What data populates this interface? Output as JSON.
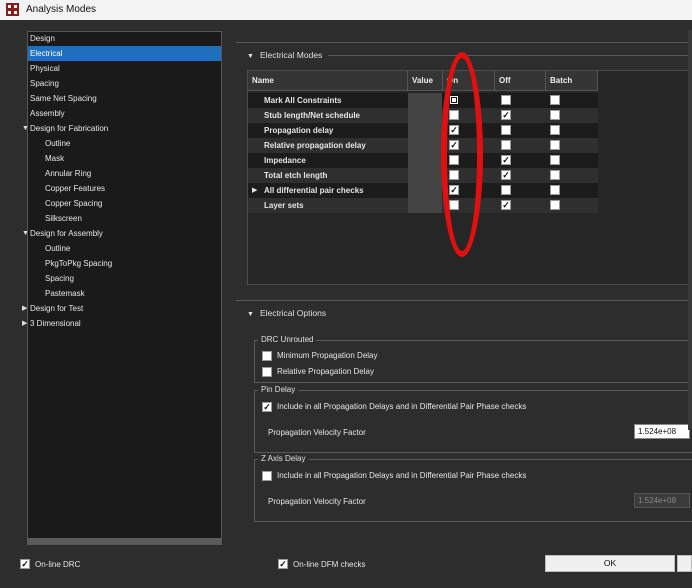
{
  "window": {
    "title": "Analysis Modes"
  },
  "nav": {
    "items": [
      {
        "label": "Design",
        "level": 0,
        "expander": "",
        "selected": false
      },
      {
        "label": "Electrical",
        "level": 0,
        "expander": "",
        "selected": true
      },
      {
        "label": "Physical",
        "level": 0,
        "expander": "",
        "selected": false
      },
      {
        "label": "Spacing",
        "level": 0,
        "expander": "",
        "selected": false
      },
      {
        "label": "Same Net Spacing",
        "level": 0,
        "expander": "",
        "selected": false
      },
      {
        "label": "Assembly",
        "level": 0,
        "expander": "",
        "selected": false
      },
      {
        "label": "Design for Fabrication",
        "level": 0,
        "expander": "▼",
        "selected": false
      },
      {
        "label": "Outline",
        "level": 1,
        "expander": "",
        "selected": false
      },
      {
        "label": "Mask",
        "level": 1,
        "expander": "",
        "selected": false
      },
      {
        "label": "Annular Ring",
        "level": 1,
        "expander": "",
        "selected": false
      },
      {
        "label": "Copper Features",
        "level": 1,
        "expander": "",
        "selected": false
      },
      {
        "label": "Copper Spacing",
        "level": 1,
        "expander": "",
        "selected": false
      },
      {
        "label": "Silkscreen",
        "level": 1,
        "expander": "",
        "selected": false
      },
      {
        "label": "Design for Assembly",
        "level": 0,
        "expander": "▼",
        "selected": false
      },
      {
        "label": "Outline",
        "level": 1,
        "expander": "",
        "selected": false
      },
      {
        "label": "PkgToPkg Spacing",
        "level": 1,
        "expander": "",
        "selected": false
      },
      {
        "label": "Spacing",
        "level": 1,
        "expander": "",
        "selected": false
      },
      {
        "label": "Pastemask",
        "level": 1,
        "expander": "",
        "selected": false
      },
      {
        "label": "Design for Test",
        "level": 0,
        "expander": "▶",
        "selected": false
      },
      {
        "label": "3 Dimensional",
        "level": 0,
        "expander": "▶",
        "selected": false
      }
    ]
  },
  "modes": {
    "section_title": "Electrical Modes",
    "columns": [
      "Name",
      "Value",
      "On",
      "Off",
      "Batch"
    ],
    "rows": [
      {
        "name": "Mark All Constraints",
        "expander": "",
        "on": false,
        "off": false,
        "batch": false,
        "dark": true
      },
      {
        "name": "Stub length/Net schedule",
        "expander": "",
        "on": false,
        "off": true,
        "batch": false,
        "dark": false
      },
      {
        "name": "Propagation delay",
        "expander": "",
        "on": true,
        "off": false,
        "batch": false,
        "dark": false
      },
      {
        "name": "Relative propagation delay",
        "expander": "",
        "on": true,
        "off": false,
        "batch": false,
        "dark": false
      },
      {
        "name": "Impedance",
        "expander": "",
        "on": false,
        "off": true,
        "batch": false,
        "dark": false
      },
      {
        "name": "Total etch length",
        "expander": "",
        "on": false,
        "off": true,
        "batch": false,
        "dark": false
      },
      {
        "name": "All differential pair checks",
        "expander": "▶",
        "on": true,
        "off": false,
        "batch": false,
        "dark": false
      },
      {
        "name": "Layer sets",
        "expander": "",
        "on": false,
        "off": true,
        "batch": false,
        "dark": false
      }
    ]
  },
  "options": {
    "section_title": "Electrical Options",
    "drc_unrouted": {
      "label": "DRC Unrouted",
      "min_prop": {
        "label": "Minimum Propagation Delay",
        "checked": false
      },
      "rel_prop": {
        "label": "Relative Propagation Delay",
        "checked": false
      }
    },
    "pin_delay": {
      "label": "Pin Delay",
      "include": {
        "label": "Include in all Propagation Delays and in Differential Pair Phase checks",
        "checked": true
      },
      "velocity_label": "Propagation Velocity Factor",
      "velocity_value": "1.524e+08"
    },
    "z_axis": {
      "label": "Z Axis Delay",
      "include": {
        "label": "Include in all Propagation Delays and in Differential Pair Phase checks",
        "checked": false
      },
      "velocity_label": "Propagation Velocity Factor",
      "velocity_value": "1.524e+08"
    }
  },
  "footer": {
    "online_drc": {
      "label": "On-line DRC",
      "checked": true
    },
    "online_dfm": {
      "label": "On-line DFM checks",
      "checked": true
    },
    "ok_label": "OK"
  },
  "annotation_color": "#e01010",
  "selection_color": "#1f6fbd"
}
